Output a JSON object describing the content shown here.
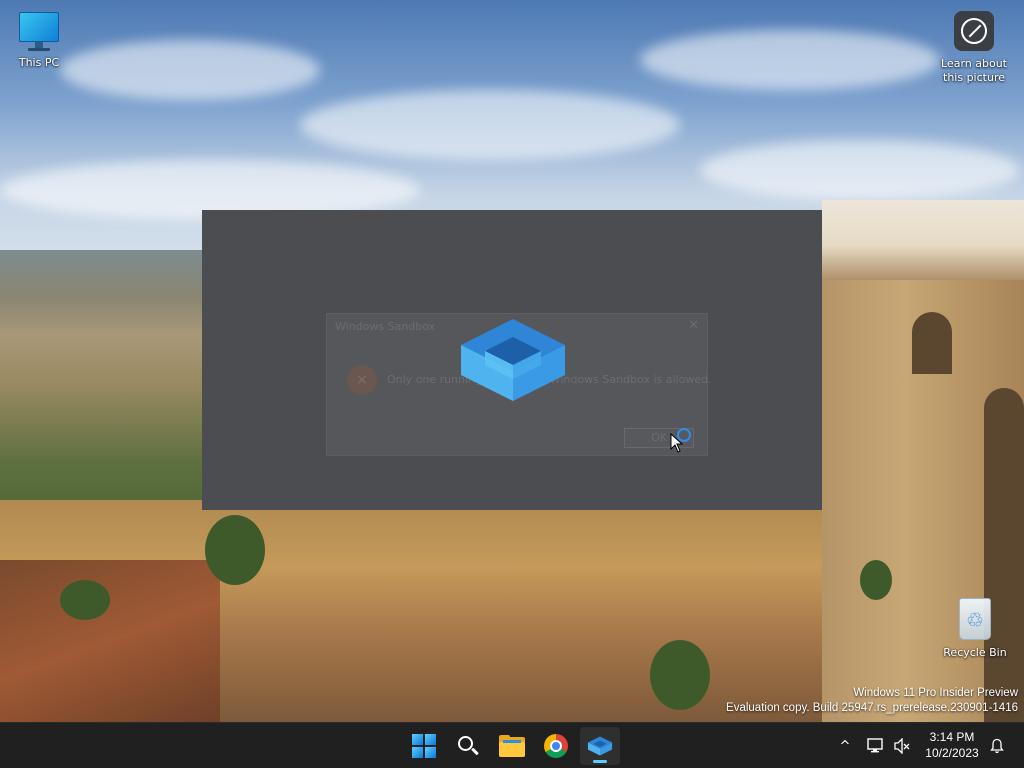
{
  "desktop": {
    "icons": [
      {
        "label": "This PC"
      },
      {
        "label_line1": "Learn about",
        "label_line2": "this picture"
      },
      {
        "label": "Recycle Bin"
      }
    ]
  },
  "watermark": {
    "line1": "Windows 11 Pro Insider Preview",
    "line2": "Evaluation copy. Build 25947.rs_prerelease.230901-1416"
  },
  "dialog": {
    "title": "Windows Sandbox",
    "message": "Only one running instance of Windows Sandbox is allowed.",
    "ok_label": "OK",
    "close_glyph": "✕",
    "error_glyph": "✕"
  },
  "taskbar": {
    "apps": [
      {
        "name": "Start",
        "icon": "windows-start-icon"
      },
      {
        "name": "Search",
        "icon": "search-icon"
      },
      {
        "name": "File Explorer",
        "icon": "folder-icon"
      },
      {
        "name": "Google Chrome",
        "icon": "chrome-icon"
      },
      {
        "name": "Windows Sandbox",
        "icon": "sandbox-icon",
        "active": true
      }
    ],
    "tray": {
      "chevron": "^",
      "time": "3:14 PM",
      "date": "10/2/2023"
    }
  },
  "colors": {
    "taskbar_bg": "#202020",
    "accent": "#60cdff",
    "sandbox_window_bg": "#4b4d50"
  }
}
